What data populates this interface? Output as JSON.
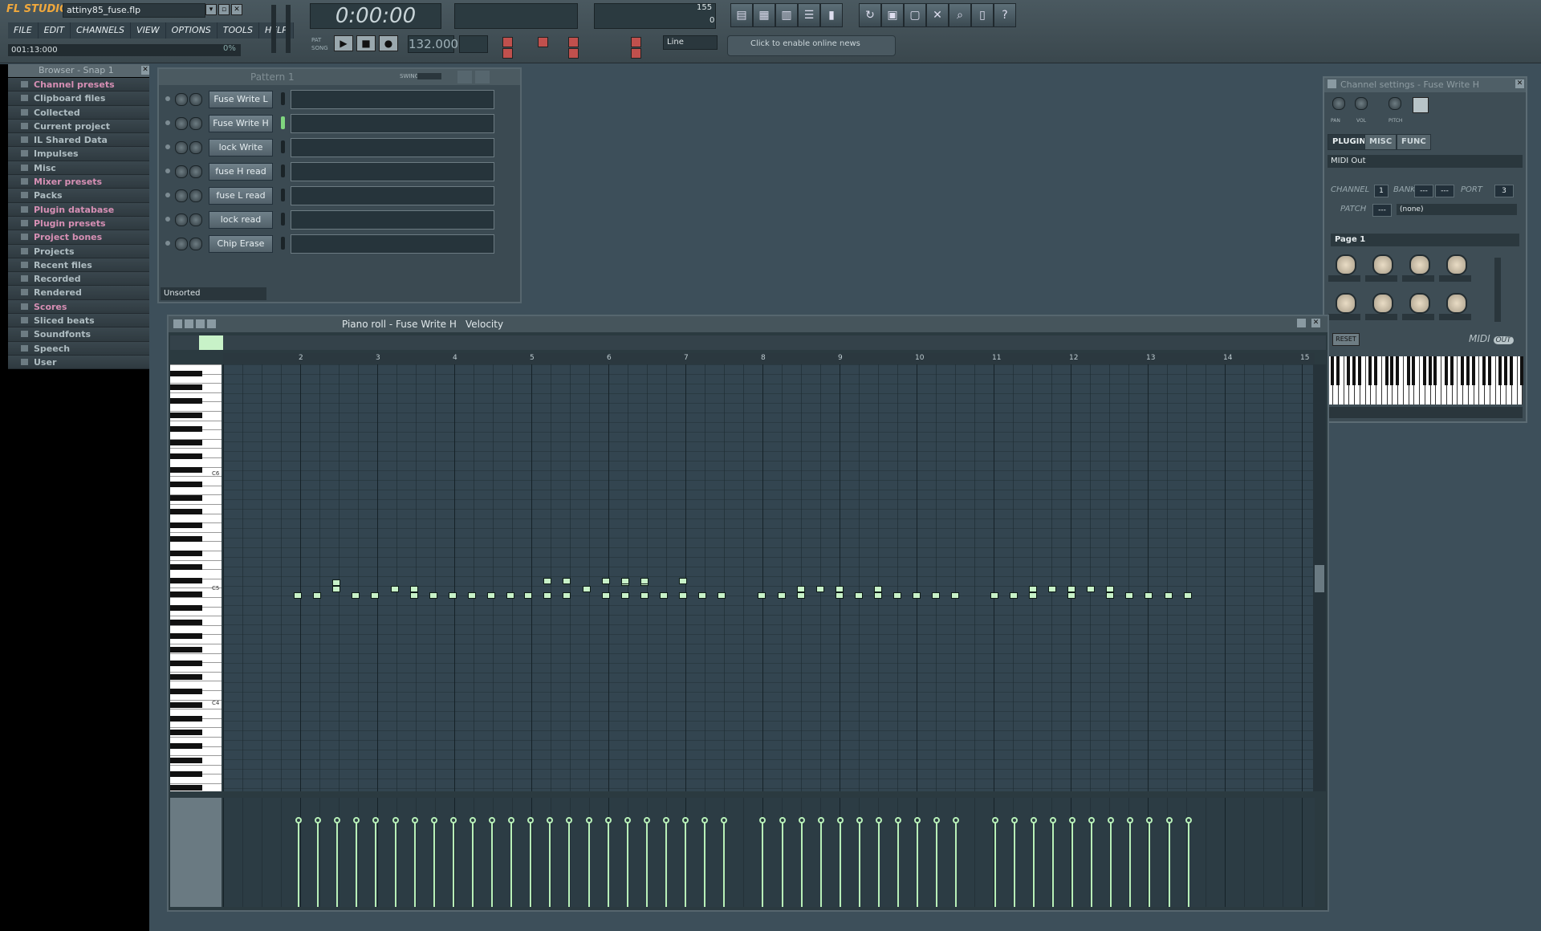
{
  "app": {
    "logo": "FL STUDIO",
    "file_name": "attiny85_fuse.flp",
    "hint": "001:13:000",
    "hint_pct": "0%"
  },
  "menu": [
    "FILE",
    "EDIT",
    "CHANNELS",
    "VIEW",
    "OPTIONS",
    "TOOLS",
    "HELP"
  ],
  "transport": {
    "time": "0:00:00",
    "tempo": "132.000",
    "mode_pat": "PAT",
    "mode_song": "SONG",
    "cpu_value": "155",
    "poly_value": "0"
  },
  "snap": {
    "value": "Line"
  },
  "news": {
    "text": "Click to enable online news"
  },
  "browser": {
    "title": "Browser - Snap 1",
    "items": [
      {
        "label": "Channel presets",
        "pink": true
      },
      {
        "label": "Clipboard files",
        "pink": false
      },
      {
        "label": "Collected",
        "pink": false
      },
      {
        "label": "Current project",
        "pink": false
      },
      {
        "label": "IL Shared Data",
        "pink": false
      },
      {
        "label": "Impulses",
        "pink": false
      },
      {
        "label": "Misc",
        "pink": false
      },
      {
        "label": "Mixer presets",
        "pink": true
      },
      {
        "label": "Packs",
        "pink": false
      },
      {
        "label": "Plugin database",
        "pink": true
      },
      {
        "label": "Plugin presets",
        "pink": true
      },
      {
        "label": "Project bones",
        "pink": true
      },
      {
        "label": "Projects",
        "pink": false
      },
      {
        "label": "Recent files",
        "pink": false
      },
      {
        "label": "Recorded",
        "pink": false
      },
      {
        "label": "Rendered",
        "pink": false
      },
      {
        "label": "Scores",
        "pink": true
      },
      {
        "label": "Sliced beats",
        "pink": false
      },
      {
        "label": "Soundfonts",
        "pink": false
      },
      {
        "label": "Speech",
        "pink": false
      },
      {
        "label": "User",
        "pink": false
      }
    ]
  },
  "step_sequencer": {
    "pattern": "Pattern 1",
    "swing_label": "SWING",
    "filter": "Unsorted",
    "channels": [
      "Fuse Write L",
      "Fuse Write H",
      "lock Write",
      "fuse H read",
      "fuse L read",
      "lock read",
      "Chip Erase"
    ],
    "selected_channel": 1
  },
  "channel_settings": {
    "title": "Channel settings - Fuse Write H",
    "knob_labels": [
      "PAN",
      "VOL",
      "PITCH"
    ],
    "tabs": [
      "PLUGIN",
      "MISC",
      "FUNC"
    ],
    "plugin": "MIDI Out",
    "channel_label": "CHANNEL",
    "channel_value": "1",
    "bank_label": "BANK",
    "bank_value": "---",
    "bank_value2": "---",
    "port_label": "PORT",
    "port_value": "3",
    "patch_label": "PATCH",
    "patch_value": "---",
    "patch_name": "(none)",
    "page": "Page 1",
    "reset": "RESET",
    "midi_logo": "MIDI",
    "midi_out": "OUT"
  },
  "piano_roll": {
    "title": "Piano roll - Fuse Write H",
    "target": "Velocity",
    "bars": [
      "2",
      "3",
      "4",
      "5",
      "6",
      "7",
      "8",
      "9",
      "10",
      "11",
      "12",
      "13",
      "14",
      "15"
    ],
    "key_labels": [
      "C6",
      "C5",
      "C4"
    ]
  }
}
